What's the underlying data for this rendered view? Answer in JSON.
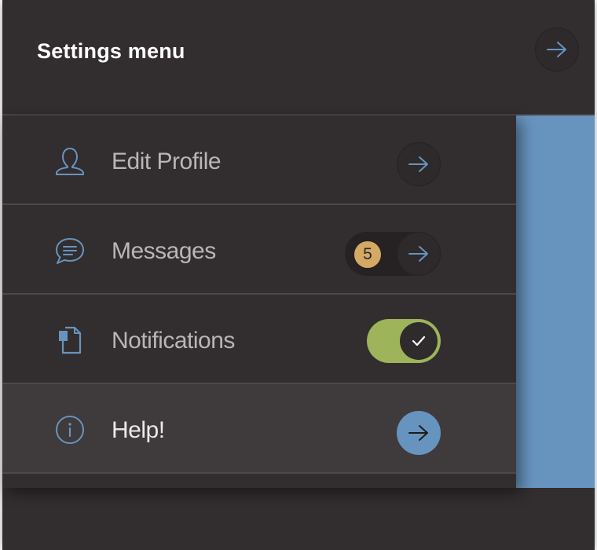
{
  "header": {
    "title": "Settings menu",
    "button_icon": "arrow-right-icon"
  },
  "menu": {
    "items": [
      {
        "label": "Edit Profile",
        "icon": "user-icon",
        "action": "arrow-right-icon"
      },
      {
        "label": "Messages",
        "icon": "chat-bubble-icon",
        "badge": "5",
        "action": "arrow-right-icon"
      },
      {
        "label": "Notifications",
        "icon": "document-icon",
        "toggle_on": true
      },
      {
        "label": "Help!",
        "icon": "info-icon",
        "action": "arrow-right-icon",
        "active": true
      }
    ]
  },
  "colors": {
    "panel_bg": "#322d2e",
    "active_bg": "#3f3a3b",
    "accent_blue": "#6794bf",
    "toggle_green": "#9db45a",
    "badge_gold": "#d3a964"
  }
}
